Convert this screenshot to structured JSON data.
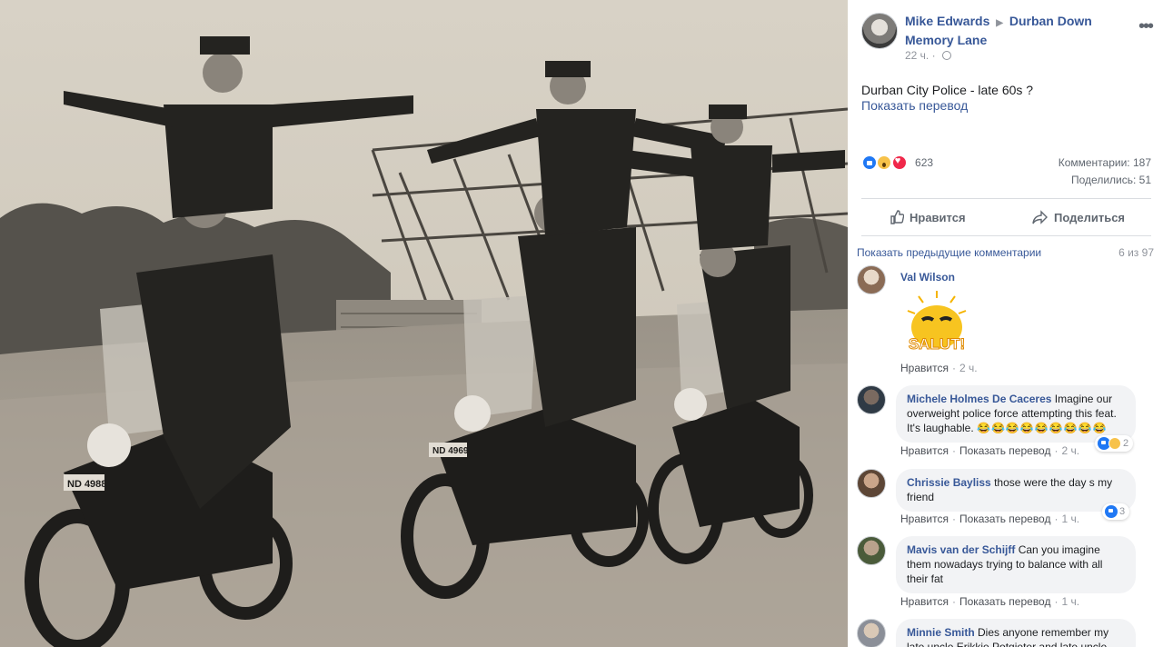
{
  "photo": {
    "plates": [
      "ND 4988",
      "ND 4969"
    ]
  },
  "post": {
    "author": "Mike Edwards",
    "group": "Durban Down Memory Lane",
    "time": "22 ч.",
    "text": "Durban City Police - late 60s ?",
    "translate": "Показать перевод",
    "reaction_count": "623",
    "comments_stat": "Комментарии: 187",
    "shares_stat": "Поделились: 51",
    "reaction_types": [
      "like-icon",
      "wow-icon",
      "love-icon"
    ]
  },
  "actions": {
    "like": "Нравится",
    "share": "Поделиться"
  },
  "comments_section": {
    "prev": "Показать предыдущие комментарии",
    "pager": "6 из 97"
  },
  "comments": [
    {
      "name": "Val Wilson",
      "text": "",
      "sticker": "SALUT!",
      "like": "Нравится",
      "time": "2 ч."
    },
    {
      "name": "Michele Holmes De Caceres",
      "text": "Imagine our overweight police force attempting this feat. It's laughable.",
      "emojis": "😂😂😂😂😂😂😂😂😂",
      "like": "Нравится",
      "translate": "Показать перевод",
      "time": "2 ч.",
      "reactions": "2"
    },
    {
      "name": "Chrissie Bayliss",
      "text": "those were the day s my friend",
      "like": "Нравится",
      "translate": "Показать перевод",
      "time": "1 ч.",
      "reactions": "3"
    },
    {
      "name": "Mavis van der Schijff",
      "text": "Can you imagine them nowadays trying to balance with all their fat",
      "like": "Нравится",
      "translate": "Показать перевод",
      "time": "1 ч."
    },
    {
      "name": "Minnie Smith",
      "text": "Dies anyone remember my late uncle Erikkie Potgieter and late uncle"
    }
  ],
  "colors": {
    "link": "#385898",
    "muted": "#90949c",
    "bubble": "#f2f3f5",
    "like_blue": "#2078f4"
  }
}
